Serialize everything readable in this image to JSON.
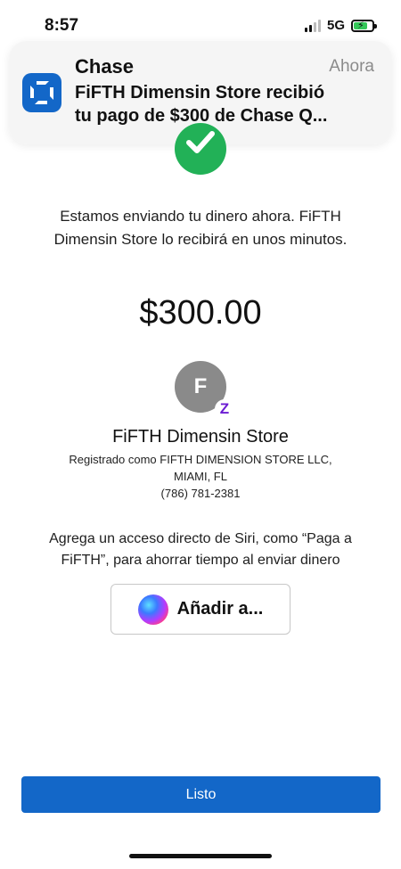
{
  "status_bar": {
    "time": "8:57",
    "network": "5G",
    "signal_bars_active": 2,
    "signal_bars_total": 4,
    "battery_level": 0.75,
    "charging_icon": "bolt-icon"
  },
  "notification": {
    "app_name": "Chase",
    "time": "Ahora",
    "body_line1": "FiFTH Dimensin Store recibió",
    "body_line2": "tu pago de $300 de Chase Q...",
    "icon": "chase-logo-icon"
  },
  "success_icon": "checkmark-icon",
  "message": "Estamos enviando tu dinero ahora. FiFTH Dimensin Store lo recibirá en unos minutos.",
  "amount": "$300.00",
  "recipient": {
    "initial": "F",
    "badge": "Z",
    "name": "FiFTH Dimensin Store",
    "registered_line1": "Registrado como FIFTH DIMENSION STORE LLC,",
    "registered_line2": "MIAMI, FL",
    "phone": "(786) 781-2381"
  },
  "siri": {
    "text": "Agrega un acceso directo de Siri, como “Paga a FiFTH”, para ahorrar tiempo al enviar dinero",
    "button_label": "Añadir a..."
  },
  "done_button": "Listo",
  "colors": {
    "accent": "#1367c8",
    "success": "#22b157",
    "zelle": "#6c1cd3",
    "avatar": "#8a8a8a"
  }
}
